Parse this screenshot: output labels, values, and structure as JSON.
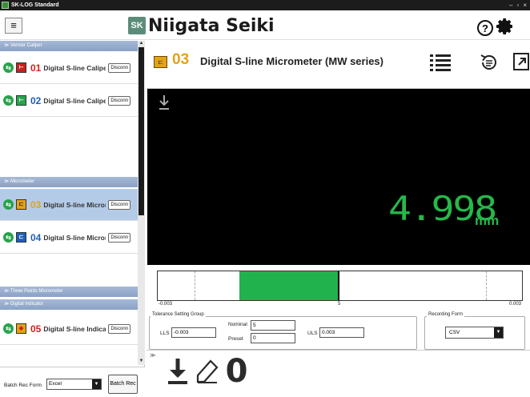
{
  "window": {
    "title": "SK-LOG Standard",
    "controls": [
      "–",
      "▫",
      "×"
    ]
  },
  "topbar": {
    "menu_label": "≡",
    "logo_mark": "SK",
    "logo_text": "Niigata Seiki",
    "help_label": "?"
  },
  "sidebar": {
    "groups": {
      "vernier": "Vernier Caliper",
      "micrometer": "Micrometer",
      "three_points": "Three Points Micrometer",
      "indicator": "Digital Indicator"
    },
    "devices": [
      {
        "num": "01",
        "name": "Digital S-line Caliper (M",
        "disconnect": "Disconn",
        "num_color": "#d32020"
      },
      {
        "num": "02",
        "name": "Digital S-line Caliper (M",
        "disconnect": "Disconn",
        "num_color": "#1d5fb8"
      },
      {
        "num": "03",
        "name": "Digital S-line Micromete",
        "disconnect": "Disconn",
        "num_color": "#e3a217"
      },
      {
        "num": "04",
        "name": "Digital S-line Micromete",
        "disconnect": "Disconn",
        "num_color": "#1d5fb8"
      },
      {
        "num": "05",
        "name": "Digital S-line Indicator [",
        "disconnect": "Disconn",
        "num_color": "#d32020"
      }
    ],
    "batch": {
      "label": "Batch Rec Form",
      "value": "Excel",
      "button": "Batch Rec"
    }
  },
  "main": {
    "device_num": "03",
    "device_name": "Digital S-line Micrometer (MW series)",
    "reading": "4.998",
    "unit": "mm",
    "gauge": {
      "low": "-0.003",
      "nominal": "5",
      "high": "0.003",
      "fill_start_pct": 22.5,
      "fill_end_pct": 49.5,
      "nominal_pct": 49.5
    },
    "tolerance": {
      "group_label": "Tolerance Setting Group",
      "lls_label": "LLS",
      "lls_value": "-0.003",
      "nominal_label": "Nominal",
      "nominal_value": "5",
      "preset_label": "Preset",
      "preset_value": "0",
      "uls_label": "ULS",
      "uls_value": "0.003"
    },
    "recording": {
      "label": "Recording Form",
      "value": "CSV"
    },
    "toolbar": {
      "collapse": "≫",
      "zero_label": "0"
    }
  }
}
